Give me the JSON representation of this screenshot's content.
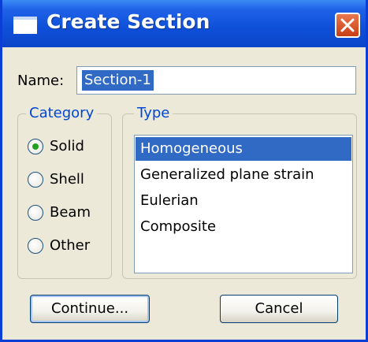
{
  "window": {
    "title": "Create Section",
    "close_icon": "close-icon"
  },
  "name": {
    "label": "Name:",
    "value": "Section-1",
    "selected": true
  },
  "category": {
    "legend": "Category",
    "options": [
      {
        "label": "Solid",
        "checked": true
      },
      {
        "label": "Shell",
        "checked": false
      },
      {
        "label": "Beam",
        "checked": false
      },
      {
        "label": "Other",
        "checked": false
      }
    ]
  },
  "type": {
    "legend": "Type",
    "items": [
      {
        "label": "Homogeneous",
        "selected": true
      },
      {
        "label": "Generalized plane strain",
        "selected": false
      },
      {
        "label": "Eulerian",
        "selected": false
      },
      {
        "label": "Composite",
        "selected": false
      }
    ]
  },
  "buttons": {
    "continue_label": "Continue...",
    "cancel_label": "Cancel"
  },
  "colors": {
    "title_bar": "#0e4fd8",
    "selection": "#316ac5",
    "legend_text": "#0046d5",
    "radio_dot": "#21a121",
    "close_button": "#d9542a"
  }
}
